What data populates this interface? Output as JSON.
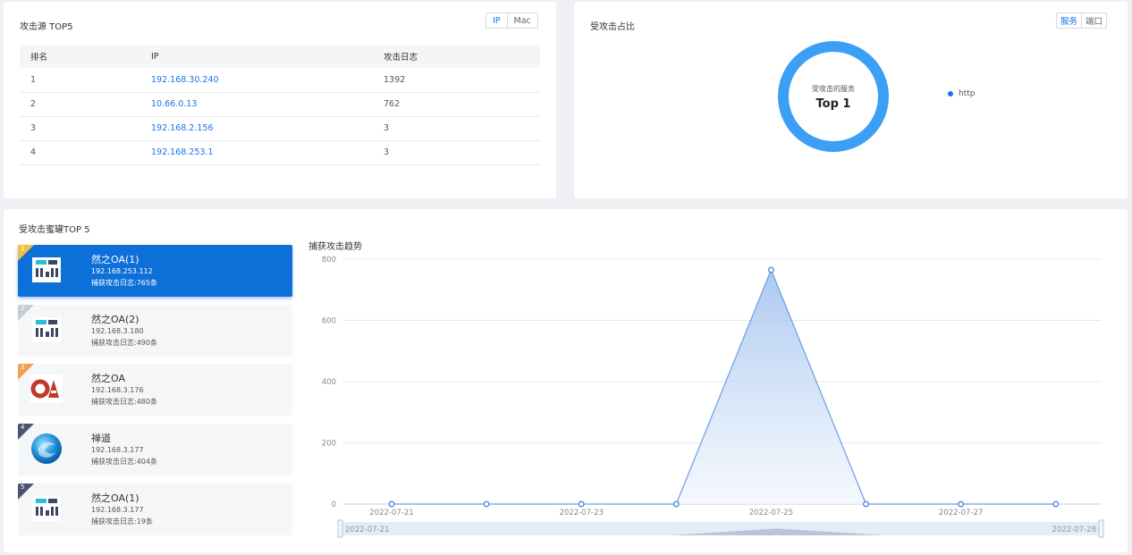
{
  "attack_source": {
    "title": "攻击源 TOP5",
    "toggle": [
      "IP",
      "Mac"
    ],
    "columns": [
      "排名",
      "IP",
      "攻击日志"
    ],
    "rows": [
      {
        "rank": "1",
        "ip": "192.168.30.240",
        "count": "1392"
      },
      {
        "rank": "2",
        "ip": "10.66.0.13",
        "count": "762"
      },
      {
        "rank": "3",
        "ip": "192.168.2.156",
        "count": "3"
      },
      {
        "rank": "4",
        "ip": "192.168.253.1",
        "count": "3"
      }
    ]
  },
  "attack_ratio": {
    "title": "受攻击占比",
    "toggle": [
      "服务",
      "端口"
    ],
    "center_label": "受攻击的服务",
    "center_value": "Top 1",
    "legend": [
      "http"
    ],
    "accent": "#3a9ff5"
  },
  "honeypots": {
    "title": "受攻击蜜罐TOP 5",
    "items": [
      {
        "rank": "1",
        "name": "然之OA(1)",
        "ip": "192.168.253.112",
        "log": "捕获攻击日志:765条",
        "icon": "server-icon",
        "corner": "#f0c040"
      },
      {
        "rank": "2",
        "name": "然之OA(2)",
        "ip": "192.168.3.180",
        "log": "捕获攻击日志:490条",
        "icon": "server-icon",
        "corner": "#c8cbd0"
      },
      {
        "rank": "3",
        "name": "然之OA",
        "ip": "192.168.3.176",
        "log": "捕获攻击日志:480条",
        "icon": "oa-logo-icon",
        "corner": "#f0a050"
      },
      {
        "rank": "4",
        "name": "禅道",
        "ip": "192.168.3.177",
        "log": "捕获攻击日志:404条",
        "icon": "zentao-logo-icon",
        "corner": "#4a5670"
      },
      {
        "rank": "5",
        "name": "然之OA(1)",
        "ip": "192.168.3.177",
        "log": "捕获攻击日志:19条",
        "icon": "server-icon",
        "corner": "#4a5670"
      }
    ]
  },
  "trend": {
    "title": "捕获攻击趋势",
    "zoom_start": "2022-07-21",
    "zoom_end": "2022-07-28"
  },
  "chart_data": {
    "type": "area",
    "title": "捕获攻击趋势",
    "x": [
      "2022-07-21",
      "2022-07-22",
      "2022-07-23",
      "2022-07-24",
      "2022-07-25",
      "2022-07-26",
      "2022-07-27",
      "2022-07-28"
    ],
    "x_tick_labels": [
      "2022-07-21",
      "2022-07-23",
      "2022-07-25",
      "2022-07-27"
    ],
    "values": [
      0,
      0,
      0,
      0,
      765,
      0,
      0,
      0
    ],
    "yticks": [
      0,
      200,
      400,
      600,
      800
    ],
    "ylim": [
      0,
      800
    ],
    "grid": true,
    "color": "#6a9ce8"
  }
}
